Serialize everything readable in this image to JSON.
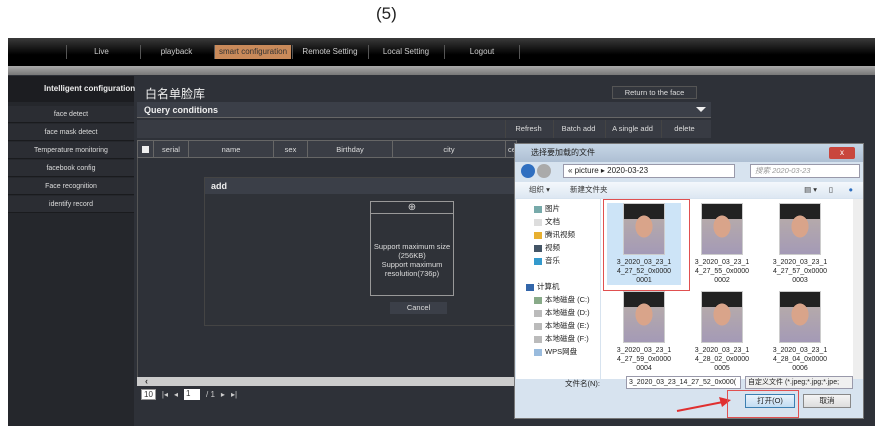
{
  "caption": "(5)",
  "nav": [
    "Live",
    "playback",
    "smart configuration",
    "Remote Setting",
    "Local Setting",
    "Logout"
  ],
  "sidebar": {
    "title": "Intelligent configuration",
    "items": [
      "face detect",
      "face mask detect",
      "Temperature monitoring",
      "facebook config",
      "Face recognition",
      "identify record"
    ]
  },
  "main": {
    "title": "白名单脸库",
    "return_button": "Return to the face",
    "query_title": "Query conditions",
    "toolbar": [
      "Refresh",
      "Batch add",
      "A single add",
      "delete"
    ],
    "columns": [
      "serial",
      "name",
      "sex",
      "Birthday",
      "city",
      "ce"
    ],
    "pagination": {
      "page_size": "10",
      "page": "1",
      "total": "/ 1"
    }
  },
  "add_dialog": {
    "title": "add",
    "upload_text": [
      "Support maximum size",
      "(256KB)",
      "Support maximum",
      "resolution(736p)"
    ],
    "cancel": "Cancel"
  },
  "file_dialog": {
    "title": "选择要加载的文件",
    "close": "x",
    "path": [
      "picture",
      "2020-03-23"
    ],
    "search_placeholder": "搜索 2020-03-23",
    "organize": "组织 ▾",
    "new_folder": "新建文件夹",
    "tree": [
      "图片",
      "文档",
      "腾讯视频",
      "视频",
      "音乐",
      "计算机",
      "本地磁盘 (C:)",
      "本地磁盘 (D:)",
      "本地磁盘 (E:)",
      "本地磁盘 (F:)",
      "WPS网盘"
    ],
    "files": [
      [
        "3_2020_03_23_1",
        "4_27_52_0x0000",
        "0001"
      ],
      [
        "3_2020_03_23_1",
        "4_27_55_0x0000",
        "0002"
      ],
      [
        "3_2020_03_23_1",
        "4_27_57_0x0000",
        "0003"
      ],
      [
        "3_2020_03_23_1",
        "4_27_59_0x0000",
        "0004"
      ],
      [
        "3_2020_03_23_1",
        "4_28_02_0x0000",
        "0005"
      ],
      [
        "3_2020_03_23_1",
        "4_28_04_0x0000",
        "0006"
      ]
    ],
    "filename_label": "文件名(N):",
    "filename": "3_2020_03_23_14_27_52_0x000(",
    "filetype": "自定义文件 (*.jpeg;*.jpg;*.jpe;",
    "open": "打开(O)",
    "cancel": "取消"
  }
}
